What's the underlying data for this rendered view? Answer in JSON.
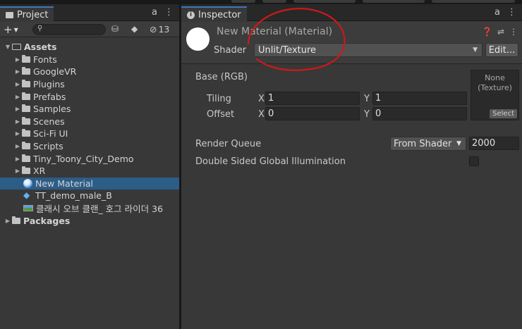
{
  "project": {
    "tab_label": "Project",
    "tab_icons": [
      "lock-icon",
      "kebab-menu-icon"
    ],
    "create_label": "+",
    "search_placeholder": "",
    "hidden_count": "13",
    "tree": [
      {
        "label": "Assets",
        "type": "open-folder",
        "depth": 0,
        "bold": true
      },
      {
        "label": "Fonts",
        "type": "folder",
        "depth": 1
      },
      {
        "label": "GoogleVR",
        "type": "folder",
        "depth": 1
      },
      {
        "label": "Plugins",
        "type": "folder",
        "depth": 1
      },
      {
        "label": "Prefabs",
        "type": "folder",
        "depth": 1
      },
      {
        "label": "Samples",
        "type": "folder",
        "depth": 1
      },
      {
        "label": "Scenes",
        "type": "folder",
        "depth": 1
      },
      {
        "label": "Sci-Fi UI",
        "type": "folder",
        "depth": 1
      },
      {
        "label": "Scripts",
        "type": "folder",
        "depth": 1
      },
      {
        "label": "Tiny_Toony_City_Demo",
        "type": "folder",
        "depth": 1
      },
      {
        "label": "XR",
        "type": "folder",
        "depth": 1
      },
      {
        "label": "New Material",
        "type": "material",
        "depth": 1,
        "selected": true
      },
      {
        "label": "TT_demo_male_B",
        "type": "prefab",
        "depth": 1
      },
      {
        "label": "클래시 오브 클랜_ 호그 라이더 36",
        "type": "image",
        "depth": 1
      },
      {
        "label": "Packages",
        "type": "folder",
        "depth": 0,
        "bold": true
      }
    ]
  },
  "inspector": {
    "tab_label": "Inspector",
    "material_title": "New Material (Material)",
    "shader_label": "Shader",
    "shader_value": "Unlit/Texture",
    "edit_label": "Edit...",
    "base_label": "Base (RGB)",
    "tiling_label": "Tiling",
    "offset_label": "Offset",
    "x_label": "X",
    "y_label": "Y",
    "tiling_x": "1",
    "tiling_y": "1",
    "offset_x": "0",
    "offset_y": "0",
    "texture_none": "None\n(Texture)",
    "texture_select": "Select",
    "render_queue_label": "Render Queue",
    "render_queue_mode": "From Shader",
    "render_queue_value": "2000",
    "double_sided_gi_label": "Double Sided Global Illumination",
    "double_sided_gi_checked": false
  },
  "colors": {
    "selection": "#2c5d87",
    "tab_accent": "#3a79bb",
    "annotation": "#d01818"
  }
}
